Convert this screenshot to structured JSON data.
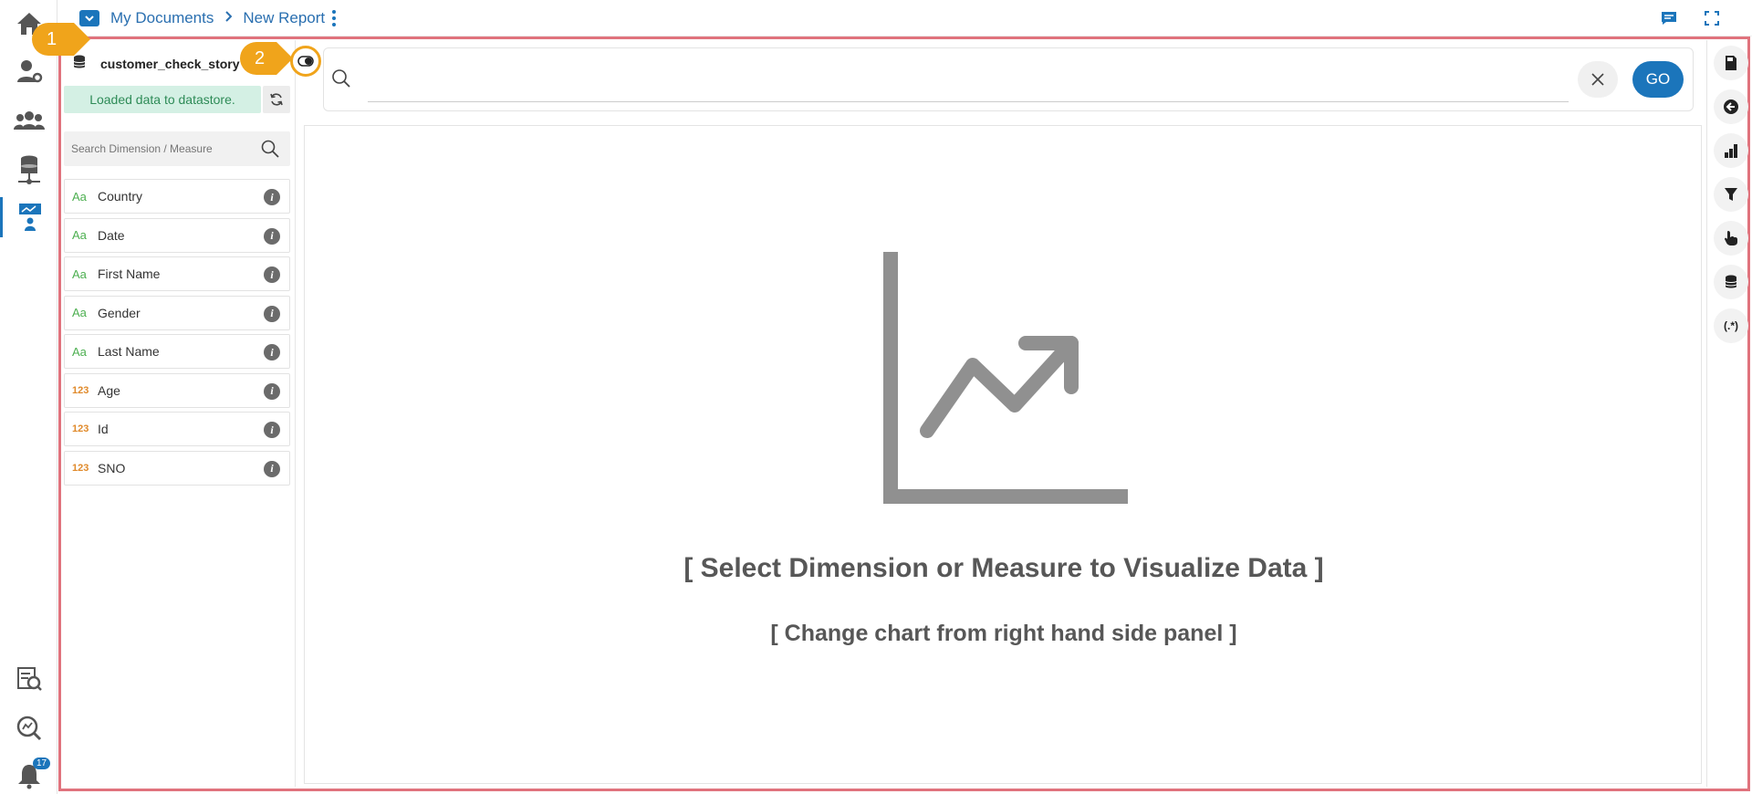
{
  "breadcrumb": {
    "root": "My Documents",
    "current": "New Report"
  },
  "callouts": {
    "one": "1",
    "two": "2"
  },
  "datasource": {
    "name": "customer_check_story",
    "status": "Loaded data to datastore.",
    "search_placeholder": "Search Dimension / Measure"
  },
  "fields": [
    {
      "type_label": "Aa",
      "kind": "dimension",
      "name": "Country"
    },
    {
      "type_label": "Aa",
      "kind": "dimension",
      "name": "Date"
    },
    {
      "type_label": "Aa",
      "kind": "dimension",
      "name": "First Name"
    },
    {
      "type_label": "Aa",
      "kind": "dimension",
      "name": "Gender"
    },
    {
      "type_label": "Aa",
      "kind": "dimension",
      "name": "Last Name"
    },
    {
      "type_label": "123",
      "kind": "measure",
      "name": "Age"
    },
    {
      "type_label": "123",
      "kind": "measure",
      "name": "Id"
    },
    {
      "type_label": "123",
      "kind": "measure",
      "name": "SNO"
    }
  ],
  "info_glyph": "i",
  "query": {
    "value": "",
    "go_label": "GO"
  },
  "canvas": {
    "message_primary": "[ Select Dimension or Measure to Visualize Data ]",
    "message_secondary": "[ Change chart from right hand side panel ]"
  },
  "right_tools": {
    "regex_label": "(.*)"
  },
  "notifications": {
    "count": "17"
  },
  "colors": {
    "accent": "#1b75bb",
    "highlight_frame": "#e0737d",
    "callout": "#f0a41b",
    "status_bg": "#d4f0e4",
    "status_text": "#2e8b57",
    "dimension": "#4caf50",
    "measure": "#e08a2b"
  }
}
